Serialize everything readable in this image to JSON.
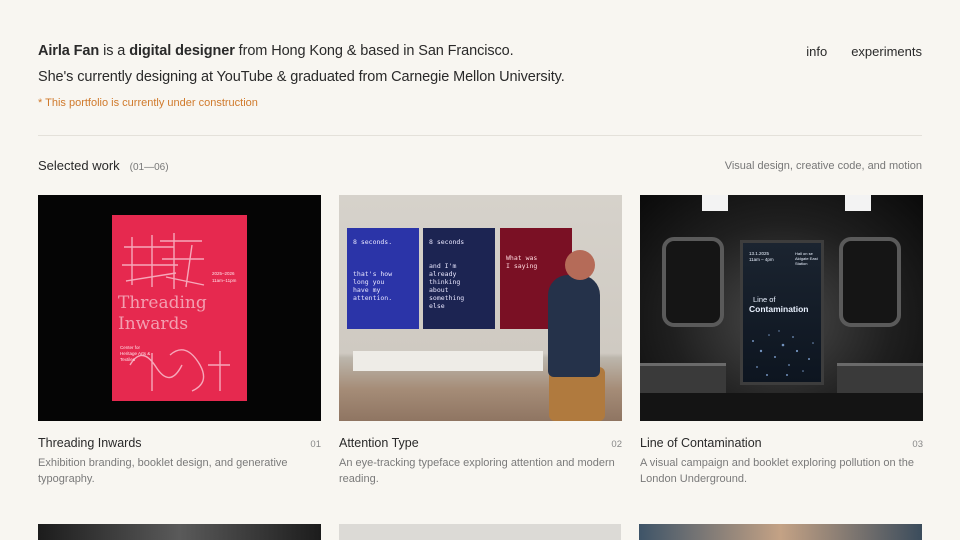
{
  "intro": {
    "name": "Airla Fan",
    "is_a": " is a ",
    "role": "digital designer",
    "line1_rest": " from Hong Kong & based in San Francisco.",
    "line2": "She's currently designing at YouTube & graduated from Carnegie Mellon University."
  },
  "note": "* This portfolio is currently under construction",
  "nav": {
    "info": "info",
    "experiments": "experiments"
  },
  "selected": {
    "title": "Selected work",
    "range": "(01—06)",
    "subtitle": "Visual design, creative code, and motion"
  },
  "colors": {
    "background": "#f8f6f1",
    "note": "#d07a2c",
    "text": "#2a2a2a",
    "muted": "#7a7a7a"
  },
  "projects": [
    {
      "title": "Threading Inwards",
      "number": "01",
      "description": "Exhibition branding, booklet design, and generative typography.",
      "thumb": {
        "big_text": "Threading Inwards",
        "dates": "2025–2026",
        "hours": "11am–11pm",
        "org": "Center for Heritage Arts & Textiles"
      }
    },
    {
      "title": "Attention Type",
      "number": "02",
      "description": "An eye-tracking typeface exploring attention and modern reading.",
      "thumb": {
        "poster1": "8 seconds.\n\n\n\nthat's how\nlong you\nhave my\nattention.",
        "poster2": "8 seconds\n\n\nand I'm\nalready\nthinking\nabout\nsomething\nelse",
        "poster3": "\n\nWhat was\nI saying"
      }
    },
    {
      "title": "Line of Contamination",
      "number": "03",
      "description": "A visual campaign and booklet exploring pollution on the London Underground.",
      "thumb": {
        "date": "13.1.2025",
        "time": "11am – 4pm",
        "venue": "Hall on se\nAldgate East\nStation",
        "line_of": "Line of",
        "contamination": "Contamination"
      }
    }
  ]
}
